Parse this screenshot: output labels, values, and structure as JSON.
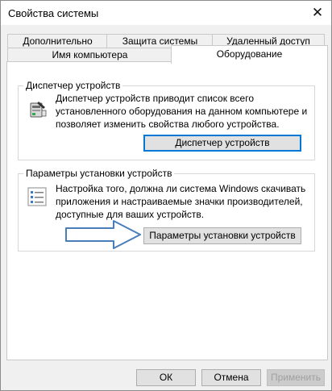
{
  "window": {
    "title": "Свойства системы",
    "close_glyph": "✕"
  },
  "tabs": {
    "back_row": [
      "Дополнительно",
      "Защита системы",
      "Удаленный доступ"
    ],
    "front_row": [
      "Имя компьютера",
      "Оборудование"
    ],
    "selected": "Оборудование"
  },
  "device_manager": {
    "group_title": "Диспетчер устройств",
    "description": [
      "Диспетчер устройств приводит список всего",
      "установленного оборудования на данном компьютере и",
      "позволяет изменить свойства любого устройства."
    ],
    "button_label": "Диспетчер устройств",
    "icon": "device-manager-icon"
  },
  "install_settings": {
    "group_title": "Параметры установки устройств",
    "description": [
      "Настройка того, должна ли система Windows скачивать",
      "приложения и настраиваемые значки производителей,",
      "доступные для ваших устройств."
    ],
    "button_label": "Параметры установки устройств",
    "icon": "checklist-icon"
  },
  "annotation": {
    "arrow": "arrow-right-icon",
    "arrow_color": "#4a7ebb"
  },
  "footer": {
    "ok_label": "ОК",
    "cancel_label": "Отмена",
    "apply_label": "Применить"
  },
  "colors": {
    "accent": "#0078d7",
    "window_bg": "#f0f0f0"
  }
}
